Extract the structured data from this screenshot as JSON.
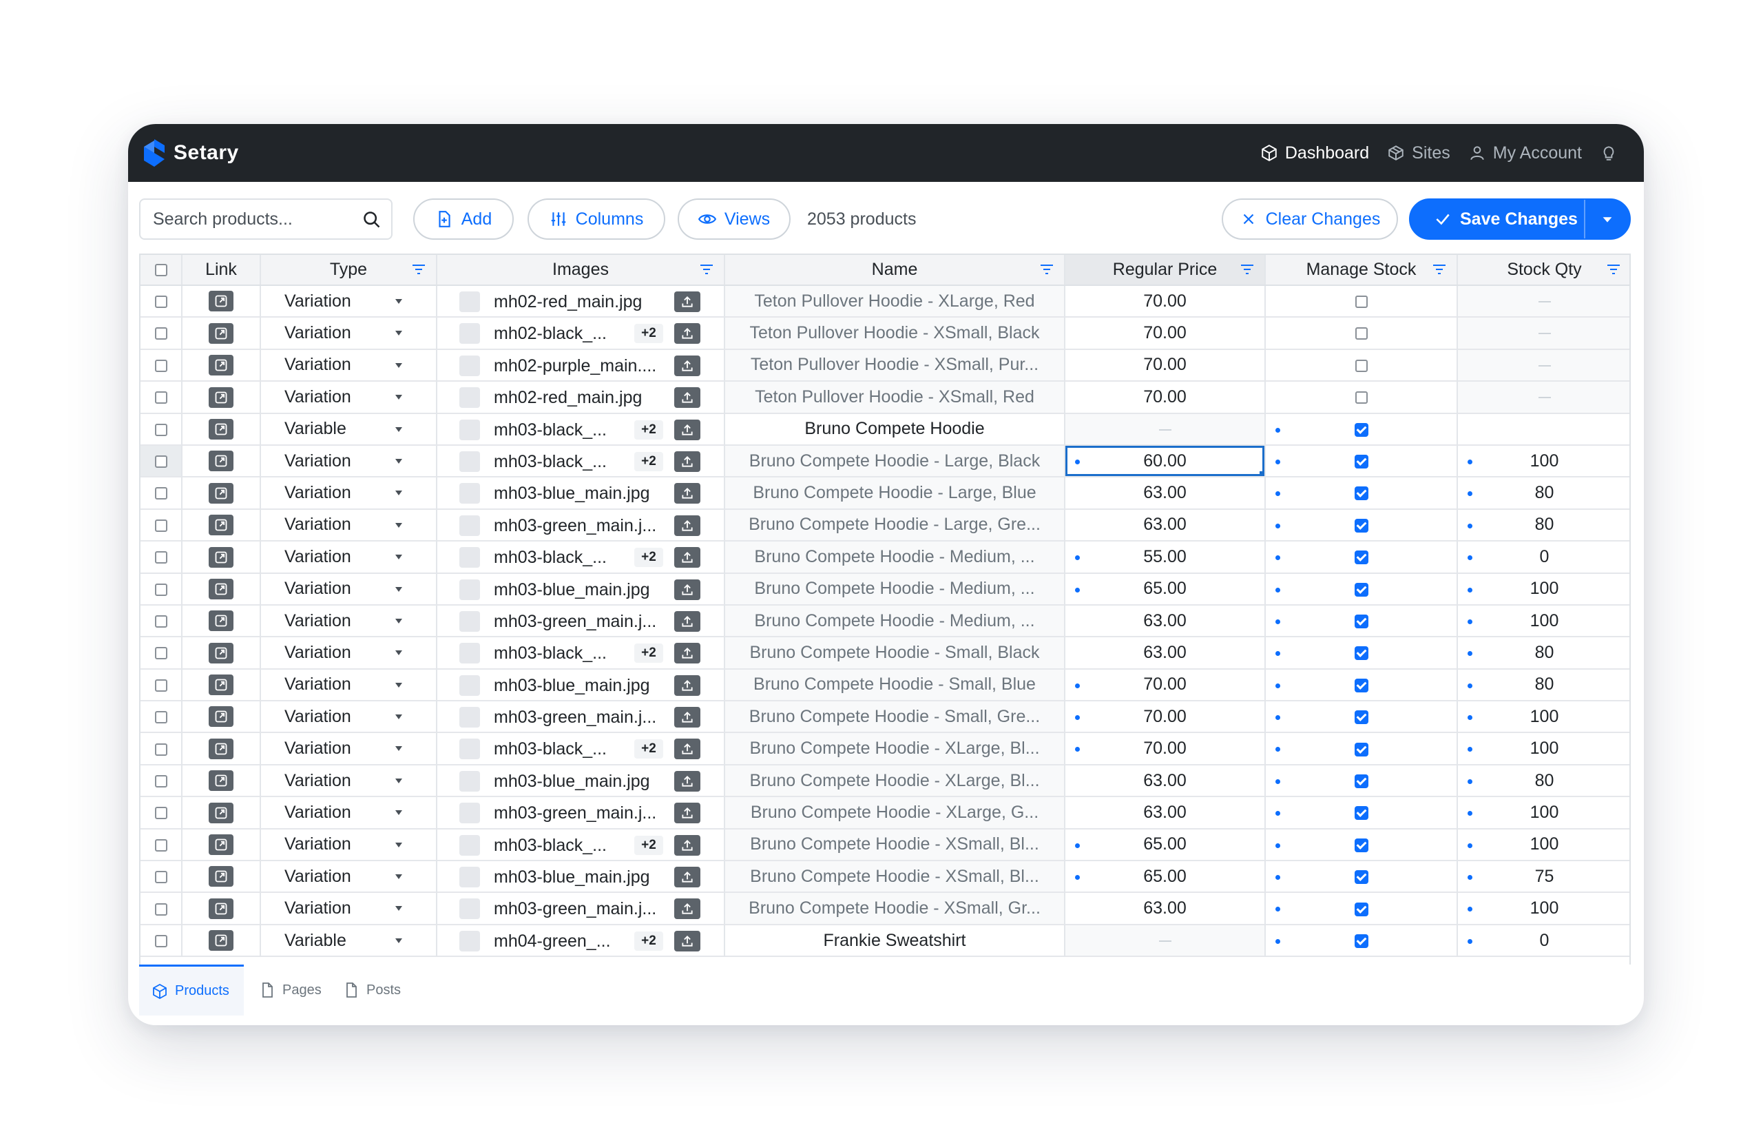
{
  "app": {
    "brand": "Setary"
  },
  "nav": {
    "dashboard": "Dashboard",
    "sites": "Sites",
    "account": "My Account"
  },
  "toolbar": {
    "search_placeholder": "Search products...",
    "add_label": "Add",
    "columns_label": "Columns",
    "views_label": "Views",
    "product_count": "2053 products",
    "clear_label": "Clear Changes",
    "save_label": "Save Changes"
  },
  "columns": {
    "link": "Link",
    "type": "Type",
    "images": "Images",
    "name": "Name",
    "regular_price": "Regular Price",
    "manage_stock": "Manage Stock",
    "stock_qty": "Stock Qty"
  },
  "rows": [
    {
      "type": "Variation",
      "image": "mh02-red_main.jpg",
      "more": "",
      "name": "Teton Pullover Hoodie - XLarge, Red",
      "price": "70.00",
      "price_edited": false,
      "manage_stock": false,
      "manage_edited": false,
      "qty": "",
      "qty_edited": false,
      "parent": false,
      "selected": false
    },
    {
      "type": "Variation",
      "image": "mh02-black_...",
      "more": "+2",
      "name": "Teton Pullover Hoodie - XSmall, Black",
      "price": "70.00",
      "price_edited": false,
      "manage_stock": false,
      "manage_edited": false,
      "qty": "",
      "qty_edited": false,
      "parent": false,
      "selected": false
    },
    {
      "type": "Variation",
      "image": "mh02-purple_main....",
      "more": "",
      "name": "Teton Pullover Hoodie - XSmall, Pur...",
      "price": "70.00",
      "price_edited": false,
      "manage_stock": false,
      "manage_edited": false,
      "qty": "",
      "qty_edited": false,
      "parent": false,
      "selected": false
    },
    {
      "type": "Variation",
      "image": "mh02-red_main.jpg",
      "more": "",
      "name": "Teton Pullover Hoodie - XSmall, Red",
      "price": "70.00",
      "price_edited": false,
      "manage_stock": false,
      "manage_edited": false,
      "qty": "",
      "qty_edited": false,
      "parent": false,
      "selected": false
    },
    {
      "type": "Variable",
      "image": "mh03-black_...",
      "more": "+2",
      "name": "Bruno Compete Hoodie",
      "price": "",
      "price_edited": false,
      "manage_stock": true,
      "manage_edited": true,
      "qty": "",
      "qty_edited": false,
      "parent": true,
      "selected": false
    },
    {
      "type": "Variation",
      "image": "mh03-black_...",
      "more": "+2",
      "name": "Bruno Compete Hoodie - Large, Black",
      "price": "60.00",
      "price_edited": true,
      "manage_stock": true,
      "manage_edited": true,
      "qty": "100",
      "qty_edited": true,
      "parent": false,
      "selected": true
    },
    {
      "type": "Variation",
      "image": "mh03-blue_main.jpg",
      "more": "",
      "name": "Bruno Compete Hoodie - Large, Blue",
      "price": "63.00",
      "price_edited": false,
      "manage_stock": true,
      "manage_edited": true,
      "qty": "80",
      "qty_edited": true,
      "parent": false,
      "selected": false
    },
    {
      "type": "Variation",
      "image": "mh03-green_main.j...",
      "more": "",
      "name": "Bruno Compete Hoodie - Large, Gre...",
      "price": "63.00",
      "price_edited": false,
      "manage_stock": true,
      "manage_edited": true,
      "qty": "80",
      "qty_edited": true,
      "parent": false,
      "selected": false
    },
    {
      "type": "Variation",
      "image": "mh03-black_...",
      "more": "+2",
      "name": "Bruno Compete Hoodie - Medium, ...",
      "price": "55.00",
      "price_edited": true,
      "manage_stock": true,
      "manage_edited": true,
      "qty": "0",
      "qty_edited": true,
      "parent": false,
      "selected": false
    },
    {
      "type": "Variation",
      "image": "mh03-blue_main.jpg",
      "more": "",
      "name": "Bruno Compete Hoodie - Medium, ...",
      "price": "65.00",
      "price_edited": true,
      "manage_stock": true,
      "manage_edited": true,
      "qty": "100",
      "qty_edited": true,
      "parent": false,
      "selected": false
    },
    {
      "type": "Variation",
      "image": "mh03-green_main.j...",
      "more": "",
      "name": "Bruno Compete Hoodie - Medium, ...",
      "price": "63.00",
      "price_edited": false,
      "manage_stock": true,
      "manage_edited": true,
      "qty": "100",
      "qty_edited": true,
      "parent": false,
      "selected": false
    },
    {
      "type": "Variation",
      "image": "mh03-black_...",
      "more": "+2",
      "name": "Bruno Compete Hoodie - Small, Black",
      "price": "63.00",
      "price_edited": false,
      "manage_stock": true,
      "manage_edited": true,
      "qty": "80",
      "qty_edited": true,
      "parent": false,
      "selected": false
    },
    {
      "type": "Variation",
      "image": "mh03-blue_main.jpg",
      "more": "",
      "name": "Bruno Compete Hoodie - Small, Blue",
      "price": "70.00",
      "price_edited": true,
      "manage_stock": true,
      "manage_edited": true,
      "qty": "80",
      "qty_edited": true,
      "parent": false,
      "selected": false
    },
    {
      "type": "Variation",
      "image": "mh03-green_main.j...",
      "more": "",
      "name": "Bruno Compete Hoodie - Small, Gre...",
      "price": "70.00",
      "price_edited": true,
      "manage_stock": true,
      "manage_edited": true,
      "qty": "100",
      "qty_edited": true,
      "parent": false,
      "selected": false
    },
    {
      "type": "Variation",
      "image": "mh03-black_...",
      "more": "+2",
      "name": "Bruno Compete Hoodie - XLarge, Bl...",
      "price": "70.00",
      "price_edited": true,
      "manage_stock": true,
      "manage_edited": true,
      "qty": "100",
      "qty_edited": true,
      "parent": false,
      "selected": false
    },
    {
      "type": "Variation",
      "image": "mh03-blue_main.jpg",
      "more": "",
      "name": "Bruno Compete Hoodie - XLarge, Bl...",
      "price": "63.00",
      "price_edited": false,
      "manage_stock": true,
      "manage_edited": true,
      "qty": "80",
      "qty_edited": true,
      "parent": false,
      "selected": false
    },
    {
      "type": "Variation",
      "image": "mh03-green_main.j...",
      "more": "",
      "name": "Bruno Compete Hoodie - XLarge, G...",
      "price": "63.00",
      "price_edited": false,
      "manage_stock": true,
      "manage_edited": true,
      "qty": "100",
      "qty_edited": true,
      "parent": false,
      "selected": false
    },
    {
      "type": "Variation",
      "image": "mh03-black_...",
      "more": "+2",
      "name": "Bruno Compete Hoodie - XSmall, Bl...",
      "price": "65.00",
      "price_edited": true,
      "manage_stock": true,
      "manage_edited": true,
      "qty": "100",
      "qty_edited": true,
      "parent": false,
      "selected": false
    },
    {
      "type": "Variation",
      "image": "mh03-blue_main.jpg",
      "more": "",
      "name": "Bruno Compete Hoodie - XSmall, Bl...",
      "price": "65.00",
      "price_edited": true,
      "manage_stock": true,
      "manage_edited": true,
      "qty": "75",
      "qty_edited": true,
      "parent": false,
      "selected": false
    },
    {
      "type": "Variation",
      "image": "mh03-green_main.j...",
      "more": "",
      "name": "Bruno Compete Hoodie - XSmall, Gr...",
      "price": "63.00",
      "price_edited": false,
      "manage_stock": true,
      "manage_edited": true,
      "qty": "100",
      "qty_edited": true,
      "parent": false,
      "selected": false
    },
    {
      "type": "Variable",
      "image": "mh04-green_...",
      "more": "+2",
      "name": "Frankie Sweatshirt",
      "price": "",
      "price_edited": false,
      "manage_stock": true,
      "manage_edited": true,
      "qty": "0",
      "qty_edited": true,
      "parent": true,
      "selected": false
    }
  ],
  "tabs": {
    "products": "Products",
    "pages": "Pages",
    "posts": "Posts"
  },
  "colors": {
    "accent": "#0d6efd",
    "topbar": "#212529",
    "edited_dot": "#0d6efd"
  }
}
